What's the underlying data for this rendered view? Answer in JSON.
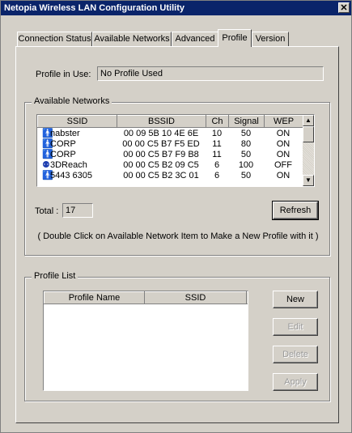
{
  "window": {
    "title": "Netopia Wireless LAN Configuration Utility",
    "close_glyph": "✕"
  },
  "tabs": [
    {
      "label": "Connection Status"
    },
    {
      "label": "Available Networks"
    },
    {
      "label": "Advanced"
    },
    {
      "label": "Profile",
      "active": true
    },
    {
      "label": "Version"
    }
  ],
  "profile_in_use": {
    "label": "Profile in Use:",
    "value": "No Profile Used"
  },
  "available_networks": {
    "group_label": "Available Networks",
    "columns": [
      "SSID",
      "BSSID",
      "Ch",
      "Signal",
      "WEP"
    ],
    "rows": [
      {
        "icon": "station-icon",
        "ssid": "nabster",
        "bssid": "00 09 5B 10 4E 6E",
        "ch": "10",
        "signal": "50",
        "wep": "ON"
      },
      {
        "icon": "station-icon",
        "ssid": "CORP",
        "bssid": "00 00 C5 B7 F5 ED",
        "ch": "11",
        "signal": "80",
        "wep": "ON"
      },
      {
        "icon": "station-icon",
        "ssid": "CORP",
        "bssid": "00 00 C5 B7 F9 B8",
        "ch": "11",
        "signal": "50",
        "wep": "ON"
      },
      {
        "icon": "access-point-icon",
        "ssid": "3DReach",
        "bssid": "00 00 C5 B2 09 C5",
        "ch": "6",
        "signal": "100",
        "wep": "OFF"
      },
      {
        "icon": "station-icon",
        "ssid": "5443 6305",
        "bssid": "00 00 C5 B2 3C 01",
        "ch": "6",
        "signal": "50",
        "wep": "ON"
      }
    ],
    "total_label": "Total :",
    "total_value": "17",
    "refresh_label": "Refresh",
    "hint": "( Double Click on Available Network Item to Make a New Profile with it )"
  },
  "profile_list": {
    "group_label": "Profile List",
    "columns": [
      "Profile Name",
      "SSID"
    ],
    "buttons": {
      "new": "New",
      "edit": "Edit",
      "delete": "Delete",
      "apply": "Apply"
    }
  }
}
